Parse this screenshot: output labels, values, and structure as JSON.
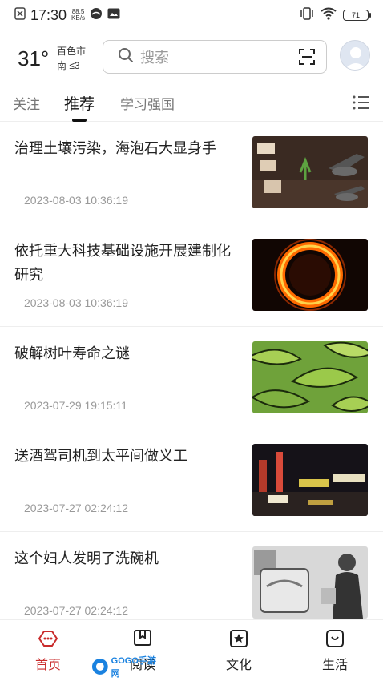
{
  "status": {
    "time": "17:30",
    "speed_value": "88.5",
    "speed_unit": "KB/s",
    "battery": "71"
  },
  "header": {
    "temperature": "31°",
    "city": "百色市",
    "wind": "南 ≤3",
    "search_placeholder": "搜索"
  },
  "tabs": [
    {
      "label": "关注"
    },
    {
      "label": "推荐"
    },
    {
      "label": "学习强国"
    }
  ],
  "news": [
    {
      "title": "治理土壤污染，海泡石大显身手",
      "time": "2023-08-03 10:36:19"
    },
    {
      "title": "依托重大科技基础设施开展建制化研究",
      "time": "2023-08-03 10:36:19"
    },
    {
      "title": "破解树叶寿命之谜",
      "time": "2023-07-29 19:15:11"
    },
    {
      "title": "送酒驾司机到太平间做义工",
      "time": "2023-07-27 02:24:12"
    },
    {
      "title": "这个妇人发明了洗碗机",
      "time": "2023-07-27 02:24:12"
    }
  ],
  "bottom_nav": [
    {
      "label": "首页"
    },
    {
      "label": "阅读"
    },
    {
      "label": "文化"
    },
    {
      "label": "生活"
    }
  ],
  "colors": {
    "accent": "#c92c2c"
  }
}
